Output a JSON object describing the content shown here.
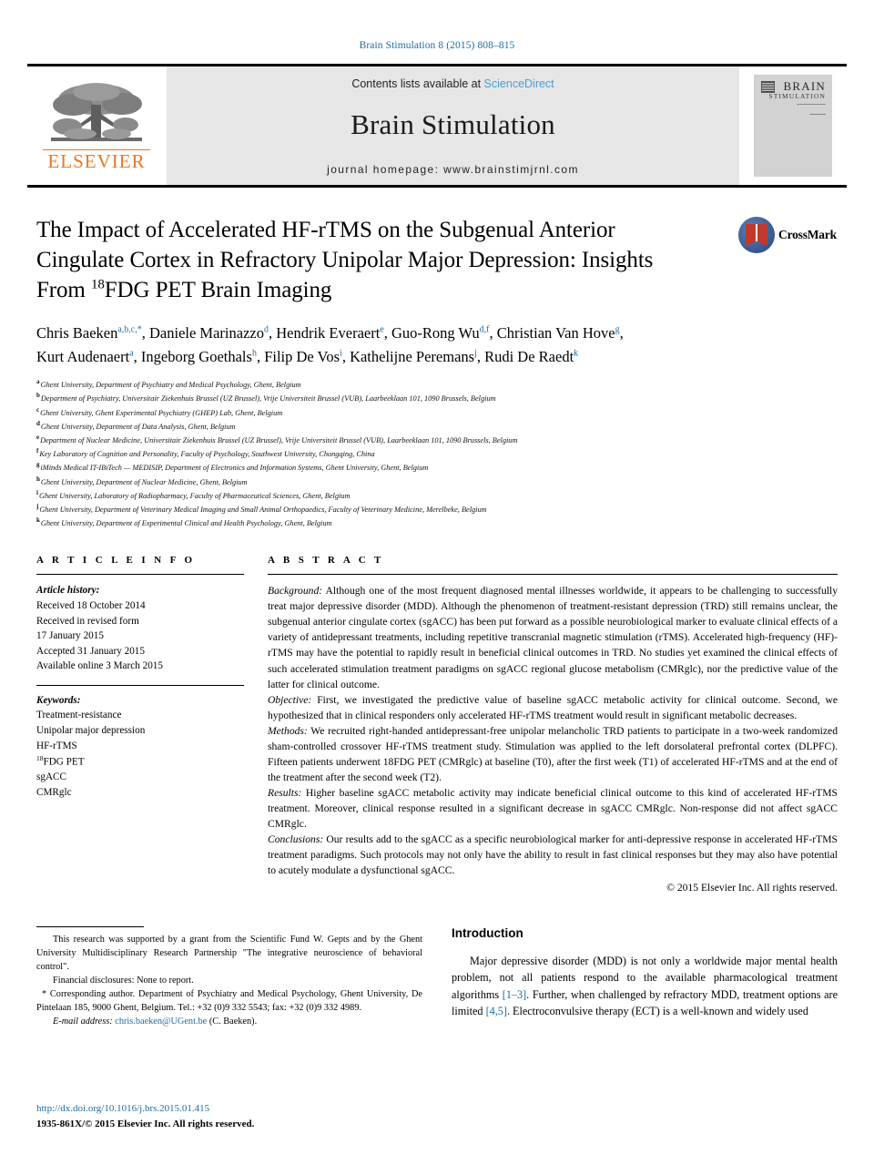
{
  "running_head": "Brain Stimulation 8 (2015) 808–815",
  "masthead": {
    "contents_prefix": "Contents lists available at ",
    "sciencedirect": "ScienceDirect",
    "journal_name": "Brain Stimulation",
    "homepage": "journal homepage: www.brainstimjrnl.com",
    "publisher": "ELSEVIER",
    "cover_title_line1": "BRAIN",
    "cover_title_line2": "STIMULATION",
    "accent_orange": "#e87722",
    "link_blue": "#1a6ca8"
  },
  "title": {
    "line1": "The Impact of Accelerated HF-rTMS on the Subgenual Anterior",
    "line2": "Cingulate Cortex in Refractory Unipolar Major Depression: Insights",
    "line3_pre": "From ",
    "line3_sup": "18",
    "line3_post": "FDG PET Brain Imaging"
  },
  "crossmark": {
    "label": "CrossMark"
  },
  "authors": [
    {
      "name": "Chris Baeken",
      "sup": "a,b,c,*"
    },
    {
      "name": "Daniele Marinazzo",
      "sup": "d"
    },
    {
      "name": "Hendrik Everaert",
      "sup": "e"
    },
    {
      "name": "Guo-Rong Wu",
      "sup": "d,f"
    },
    {
      "name": "Christian Van Hove",
      "sup": "g"
    },
    {
      "name": "Kurt Audenaert",
      "sup": "a"
    },
    {
      "name": "Ingeborg Goethals",
      "sup": "h"
    },
    {
      "name": "Filip De Vos",
      "sup": "i"
    },
    {
      "name": "Kathelijne Peremans",
      "sup": "j"
    },
    {
      "name": "Rudi De Raedt",
      "sup": "k"
    }
  ],
  "affiliations": [
    {
      "mark": "a",
      "text": "Ghent University, Department of Psychiatry and Medical Psychology, Ghent, Belgium"
    },
    {
      "mark": "b",
      "text": "Department of Psychiatry, Universitair Ziekenhuis Brussel (UZ Brussel), Vrije Universiteit Brussel (VUB), Laarbeeklaan 101, 1090 Brussels, Belgium"
    },
    {
      "mark": "c",
      "text": "Ghent University, Ghent Experimental Psychiatry (GHEP) Lab, Ghent, Belgium"
    },
    {
      "mark": "d",
      "text": "Ghent University, Department of Data Analysis, Ghent, Belgium"
    },
    {
      "mark": "e",
      "text": "Department of Nuclear Medicine, Universitair Ziekenhuis Brussel (UZ Brussel), Vrije Universiteit Brussel (VUB), Laarbeeklaan 101, 1090 Brussels, Belgium"
    },
    {
      "mark": "f",
      "text": "Key Laboratory of Cognition and Personality, Faculty of Psychology, Southwest University, Chongqing, China"
    },
    {
      "mark": "g",
      "text": "iMinds Medical IT-IBiTech — MEDISIP, Department of Electronics and Information Systems, Ghent University, Ghent, Belgium"
    },
    {
      "mark": "h",
      "text": "Ghent University, Department of Nuclear Medicine, Ghent, Belgium"
    },
    {
      "mark": "i",
      "text": "Ghent University, Laboratory of Radiopharmacy, Faculty of Pharmaceutical Sciences, Ghent, Belgium"
    },
    {
      "mark": "j",
      "text": "Ghent University, Department of Veterinary Medical Imaging and Small Animal Orthopaedics, Faculty of Veterinary Medicine, Merelbeke, Belgium"
    },
    {
      "mark": "k",
      "text": "Ghent University, Department of Experimental Clinical and Health Psychology, Ghent, Belgium"
    }
  ],
  "article_info": {
    "heading": "A R T I C L E    I N F O",
    "history_label": "Article history:",
    "history": [
      "Received 18 October 2014",
      "Received in revised form",
      "17 January 2015",
      "Accepted 31 January 2015",
      "Available online 3 March 2015"
    ],
    "keywords_label": "Keywords:",
    "keywords": [
      "Treatment-resistance",
      "Unipolar major depression",
      "HF-rTMS",
      "18FDG PET",
      "sgACC",
      "CMRglc"
    ],
    "keyword_fdg_sup": "18",
    "keyword_fdg_rest": "FDG PET"
  },
  "abstract": {
    "heading": "A B S T R A C T",
    "paragraphs": [
      {
        "lead": "Background:",
        "text": " Although one of the most frequent diagnosed mental illnesses worldwide, it appears to be challenging to successfully treat major depressive disorder (MDD). Although the phenomenon of treatment-resistant depression (TRD) still remains unclear, the subgenual anterior cingulate cortex (sgACC) has been put forward as a possible neurobiological marker to evaluate clinical effects of a variety of antidepressant treatments, including repetitive transcranial magnetic stimulation (rTMS). Accelerated high-frequency (HF)-rTMS may have the potential to rapidly result in beneficial clinical outcomes in TRD. No studies yet examined the clinical effects of such accelerated stimulation treatment paradigms on sgACC regional glucose metabolism (CMRglc), nor the predictive value of the latter for clinical outcome."
      },
      {
        "lead": "Objective:",
        "text": " First, we investigated the predictive value of baseline sgACC metabolic activity for clinical outcome. Second, we hypothesized that in clinical responders only accelerated HF-rTMS treatment would result in significant metabolic decreases."
      },
      {
        "lead": "Methods:",
        "text": " We recruited right-handed antidepressant-free unipolar melancholic TRD patients to participate in a two-week randomized sham-controlled crossover HF-rTMS treatment study. Stimulation was applied to the left dorsolateral prefrontal cortex (DLPFC). Fifteen patients underwent 18FDG PET (CMRglc) at baseline (T0), after the first week (T1) of accelerated HF-rTMS and at the end of the treatment after the second week (T2)."
      },
      {
        "lead": "Results:",
        "text": " Higher baseline sgACC metabolic activity may indicate beneficial clinical outcome to this kind of accelerated HF-rTMS treatment. Moreover, clinical response resulted in a significant decrease in sgACC CMRglc. Non-response did not affect sgACC CMRglc."
      },
      {
        "lead": "Conclusions:",
        "text": " Our results add to the sgACC as a specific neurobiological marker for anti-depressive response in accelerated HF-rTMS treatment paradigms. Such protocols may not only have the ability to result in fast clinical responses but they may also have potential to acutely modulate a dysfunctional sgACC."
      }
    ],
    "copyright": "© 2015 Elsevier Inc. All rights reserved."
  },
  "footnotes": {
    "grant": "This research was supported by a grant from the Scientific Fund W. Gepts and by the Ghent University Multidisciplinary Research Partnership \"The integrative neuroscience of behavioral control\".",
    "disclosures": "Financial disclosures: None to report.",
    "corresponding": "* Corresponding author. Department of Psychiatry and Medical Psychology, Ghent University, De Pintelaan 185, 9000 Ghent, Belgium. Tel.: +32 (0)9 332 5543; fax: +32 (0)9 332 4989.",
    "email_label": "E-mail address:",
    "email": "chris.baeken@UGent.be",
    "email_suffix": " (C. Baeken)."
  },
  "introduction": {
    "heading": "Introduction",
    "text_p1_a": "Major depressive disorder (MDD) is not only a worldwide major mental health problem, not all patients respond to the available pharmacological treatment algorithms ",
    "ref1": "[1–3]",
    "text_p1_b": ". Further, when challenged by refractory MDD, treatment options are limited ",
    "ref2": "[4,5]",
    "text_p1_c": ". Electroconvulsive therapy (ECT) is a well-known and widely used"
  },
  "doi_footer": {
    "doi": "http://dx.doi.org/10.1016/j.brs.2015.01.415",
    "issn_line": "1935-861X/© 2015 Elsevier Inc. All rights reserved."
  }
}
